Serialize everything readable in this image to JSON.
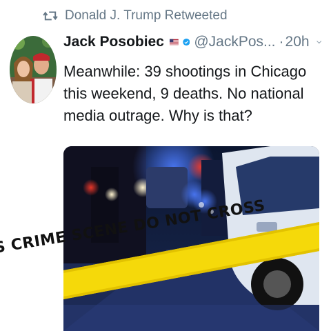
{
  "retweet": {
    "label": "Donald J. Trump Retweeted",
    "icon": "retweet-icon"
  },
  "tweet": {
    "author_name": "Jack Posobiec",
    "flag_icon": "us-flag-icon",
    "verified_icon": "verified-badge-icon",
    "handle": "@JackPos...",
    "separator": "·",
    "time": "20h",
    "menu_icon": "chevron-down-icon",
    "text": "Meanwhile: 39 shootings in Chicago this weekend, 9 deaths. No national media outrage. Why is that?"
  },
  "media": {
    "tape_text": "S   CRIME SCENE DO NOT CROSS",
    "colors": {
      "tape": "#f5d90a",
      "night_blue": "#0a1a3a",
      "police_light": "#2a5bd6"
    }
  },
  "colors": {
    "muted": "#657786",
    "verified": "#1da1f2"
  }
}
